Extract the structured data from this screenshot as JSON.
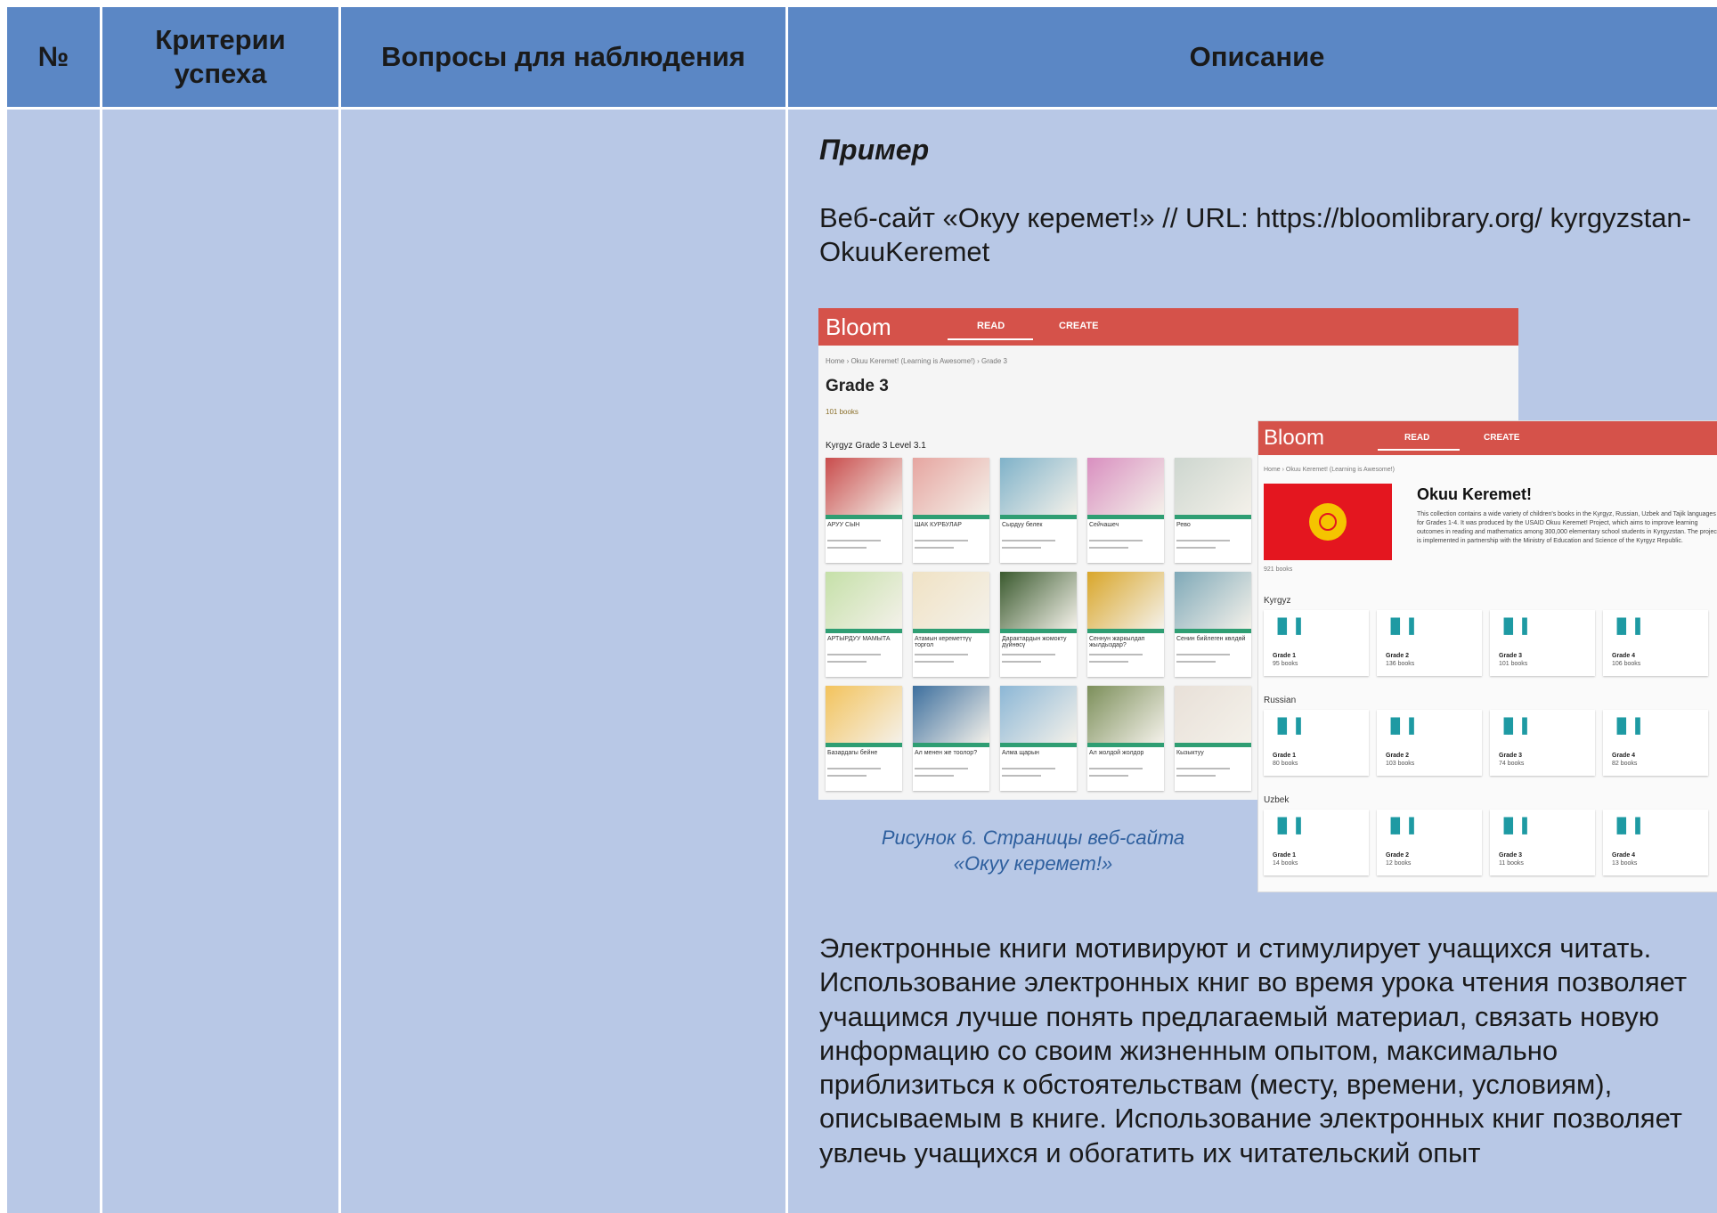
{
  "table": {
    "headers": {
      "num": "№",
      "criteria": "Критерии успеха",
      "questions": "Вопросы для наблюдения",
      "description": "Описание"
    }
  },
  "description": {
    "example_label": "Пример",
    "website_text": "Веб-сайт «Окуу керемет!» // URL: https://bloomlibrary.org/ kyrgyzstan-OkuuKeremet",
    "caption_line1": "Рисунок 6. Страницы веб-сайта",
    "caption_line2": "«Окуу керемет!»",
    "paragraph": "Электронные книги мотивируют и стимулирует учащихся читать. Использование электронных книг во время урока чтения позволяет учащимся лучше понять предлагаемый материал, связать новую информацию со своим жизненным опытом, максимально приблизиться к обстоятельствам (месту, времени, условиям), описываемым в книге. Использование электронных книг позволяет увлечь учащихся и обогатить их читательский опыт"
  },
  "screenshot1": {
    "logo": "Bloom",
    "nav_read": "READ",
    "nav_create": "CREATE",
    "breadcrumb": "Home › Okuu Keremet! (Learning is Awesome!) › Grade 3",
    "title": "Grade 3",
    "book_count": "101 books",
    "shelf_title": "Kyrgyz Grade 3 Level 3.1",
    "book_titles": [
      "АРУУ СЫН",
      "ШАК КУРБУЛАР",
      "Сырдуу белек",
      "Сейчашеч",
      "Рево",
      "АРТЫРДУУ МАМЫТА",
      "Атамын кереметтүү торгол",
      "Дарактардын жомокту дүйнөсү",
      "Сеннун жаркылдап жылдыздар?",
      "Сенин бийлеген көлдөй",
      "Базардагы бейне",
      "Ал менен же тоолор?",
      "Алма щарын",
      "Ал жолдой жолдор",
      "Кызыктуу"
    ]
  },
  "screenshot2": {
    "logo": "Bloom",
    "nav_read": "READ",
    "nav_create": "CREATE",
    "breadcrumb": "Home › Okuu Keremet! (Learning is Awesome!)",
    "title": "Okuu Keremet!",
    "desc": "This collection contains a wide variety of children's books in the Kyrgyz, Russian, Uzbek and Tajik languages for Grades 1-4. It was produced by the USAID Okuu Keremet! Project, which aims to improve learning outcomes in reading and mathematics among 300,000 elementary school students in Kyrgyzstan. The project is implemented in partnership with the Ministry of Education and Science of the Kyrgyz Republic.",
    "book_count": "921 books",
    "sections": [
      {
        "name": "Kyrgyz",
        "grades": [
          {
            "g": "Grade 1",
            "b": "95 books"
          },
          {
            "g": "Grade 2",
            "b": "136 books"
          },
          {
            "g": "Grade 3",
            "b": "101 books"
          },
          {
            "g": "Grade 4",
            "b": "106 books"
          }
        ]
      },
      {
        "name": "Russian",
        "grades": [
          {
            "g": "Grade 1",
            "b": "80 books"
          },
          {
            "g": "Grade 2",
            "b": "103 books"
          },
          {
            "g": "Grade 3",
            "b": "74 books"
          },
          {
            "g": "Grade 4",
            "b": "82 books"
          }
        ]
      },
      {
        "name": "Uzbek",
        "grades": [
          {
            "g": "Grade 1",
            "b": "14 books"
          },
          {
            "g": "Grade 2",
            "b": "12 books"
          },
          {
            "g": "Grade 3",
            "b": "11 books"
          },
          {
            "g": "Grade 4",
            "b": "13 books"
          }
        ]
      }
    ]
  }
}
